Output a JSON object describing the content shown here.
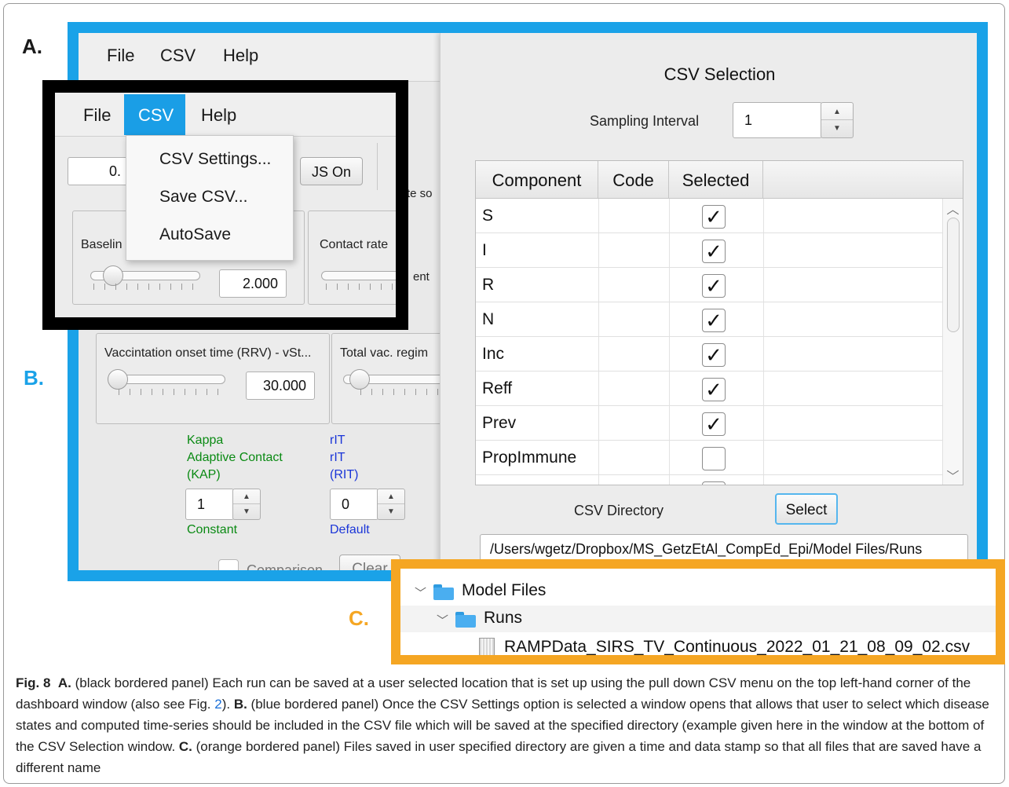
{
  "labels": {
    "a": "A.",
    "b": "B.",
    "c": "C."
  },
  "dashboard": {
    "menu": [
      "File",
      "CSV",
      "Help"
    ],
    "partial_text": {
      "te_so": "te so",
      "ent": "ent"
    },
    "vaccination": {
      "label": "Vaccintation onset time (RRV) - vSt...",
      "value": "30.000",
      "total_label": "Total vac. regim"
    },
    "kappa": {
      "line1": "Kappa",
      "line2": "Adaptive Contact",
      "line3": "(KAP)",
      "value": "1",
      "mode": "Constant"
    },
    "rit": {
      "line1": "rIT",
      "line2": "rIT",
      "line3": "(RIT)",
      "value": "0",
      "mode": "Default"
    },
    "bottom": {
      "comparison": "Comparison",
      "clear": "Clear"
    }
  },
  "black_panel": {
    "menu": [
      "File",
      "CSV",
      "Help"
    ],
    "value_partial": "0.",
    "js_on": "JS On",
    "baseline": "Baselin",
    "baseline_paren": ")",
    "baseline_value": "2.000",
    "contact_rate": "Contact rate",
    "csv_menu_items": [
      "CSV Settings...",
      "Save CSV...",
      "AutoSave"
    ]
  },
  "csv_window": {
    "title": "CSV Selection",
    "sampling_label": "Sampling Interval",
    "sampling_value": "1",
    "columns": [
      "Component",
      "Code",
      "Selected"
    ],
    "rows": [
      {
        "name": "S",
        "checked": true
      },
      {
        "name": "I",
        "checked": true
      },
      {
        "name": "R",
        "checked": true
      },
      {
        "name": "N",
        "checked": true
      },
      {
        "name": "Inc",
        "checked": true
      },
      {
        "name": "Reff",
        "checked": true
      },
      {
        "name": "Prev",
        "checked": true
      },
      {
        "name": "PropImmune",
        "checked": false
      }
    ],
    "directory_label": "CSV Directory",
    "select_button": "Select",
    "directory_path": "/Users/wgetz/Dropbox/MS_GetzEtAl_CompEd_Epi/Model Files/Runs"
  },
  "file_tree": {
    "items": [
      "Model Files",
      "Runs",
      "RAMPData_SIRS_TV_Continuous_2022_01_21_08_09_02.csv"
    ]
  },
  "caption": {
    "fig": "Fig. 8",
    "a_label": "A.",
    "a_text": " (black bordered panel) Each run can be saved at a user selected location that is set up using the pull down CSV menu on the top left-hand corner of the dashboard window (also see Fig. ",
    "fig_ref": "2",
    "a_text2": "). ",
    "b_label": "B.",
    "b_text": " (blue bordered panel) Once the CSV Settings option is selected a window opens that allows that user to select which disease states and computed time-series should be included in the CSV file which will be saved at the specified directory (example given here in the window at the bottom of the CSV Selection window. ",
    "c_label": "C.",
    "c_text": " (orange bordered panel) Files saved in user specified directory are given a time and data stamp so that all files that are saved have a different name"
  }
}
